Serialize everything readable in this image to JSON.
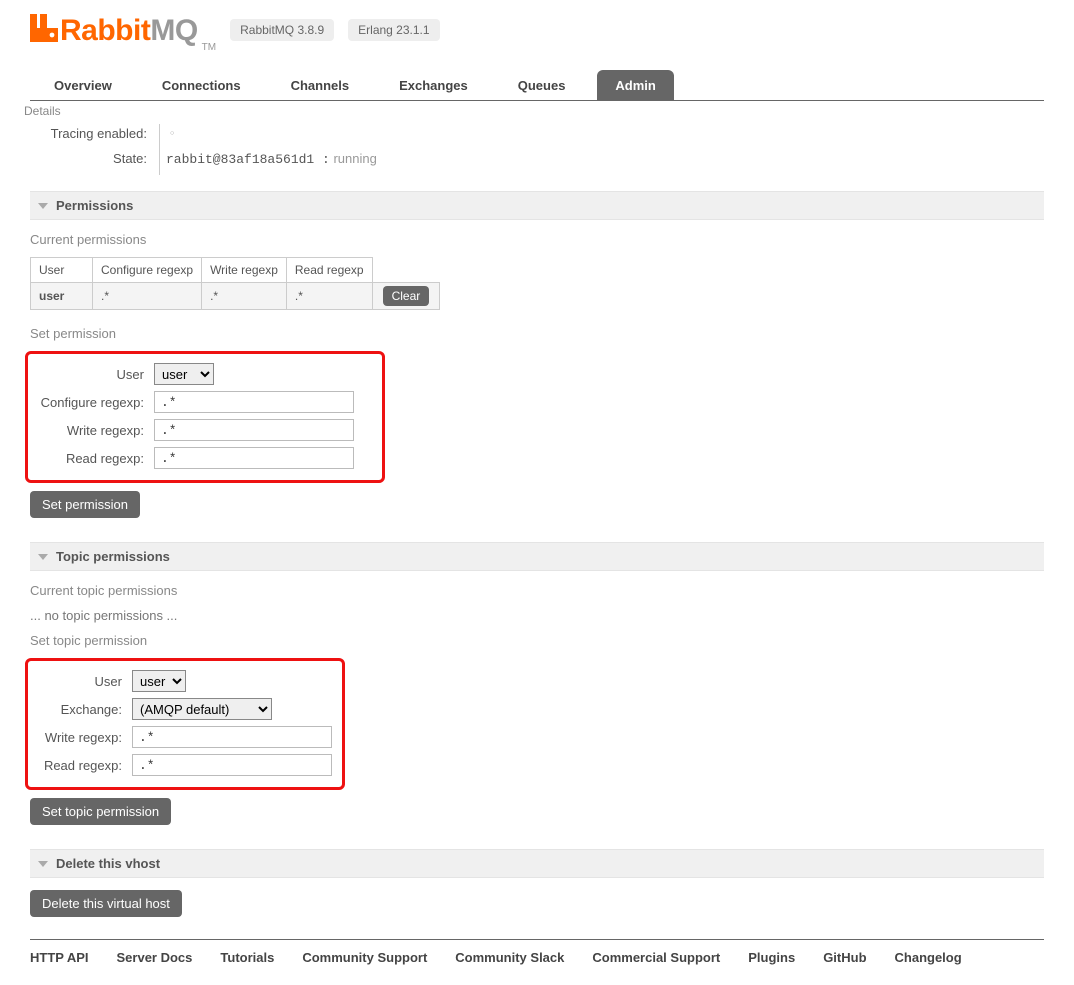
{
  "header": {
    "brand1": "Rabbit",
    "brand2": "MQ",
    "tm": "TM",
    "badges": [
      "RabbitMQ 3.8.9",
      "Erlang 23.1.1"
    ]
  },
  "tabs": {
    "items": [
      "Overview",
      "Connections",
      "Channels",
      "Exchanges",
      "Queues",
      "Admin"
    ],
    "active": 5
  },
  "details": {
    "title": "Details",
    "tracing_label": "Tracing enabled:",
    "tracing_value": "○",
    "state_label": "State:",
    "state_node": "rabbit@83af18a561d1 :",
    "state_status": "running"
  },
  "permissions": {
    "section_title": "Permissions",
    "current_title": "Current permissions",
    "headers": [
      "User",
      "Configure regexp",
      "Write regexp",
      "Read regexp"
    ],
    "row": {
      "user": "user",
      "configure": ".*",
      "write": ".*",
      "read": ".*"
    },
    "clear_label": "Clear",
    "set_title": "Set permission",
    "form": {
      "user_label": "User",
      "user_value": "user",
      "configure_label": "Configure regexp:",
      "configure_value": ".*",
      "write_label": "Write regexp:",
      "write_value": ".*",
      "read_label": "Read regexp:",
      "read_value": ".*"
    },
    "set_button": "Set permission"
  },
  "topic": {
    "section_title": "Topic permissions",
    "current_title": "Current topic permissions",
    "none_msg": "... no topic permissions ...",
    "set_title": "Set topic permission",
    "form": {
      "user_label": "User",
      "user_value": "user",
      "exchange_label": "Exchange:",
      "exchange_value": "(AMQP default)",
      "write_label": "Write regexp:",
      "write_value": ".*",
      "read_label": "Read regexp:",
      "read_value": ".*"
    },
    "set_button": "Set topic permission"
  },
  "delete": {
    "section_title": "Delete this vhost",
    "button": "Delete this virtual host"
  },
  "footer": {
    "links": [
      "HTTP API",
      "Server Docs",
      "Tutorials",
      "Community Support",
      "Community Slack",
      "Commercial Support",
      "Plugins",
      "GitHub",
      "Changelog"
    ]
  }
}
